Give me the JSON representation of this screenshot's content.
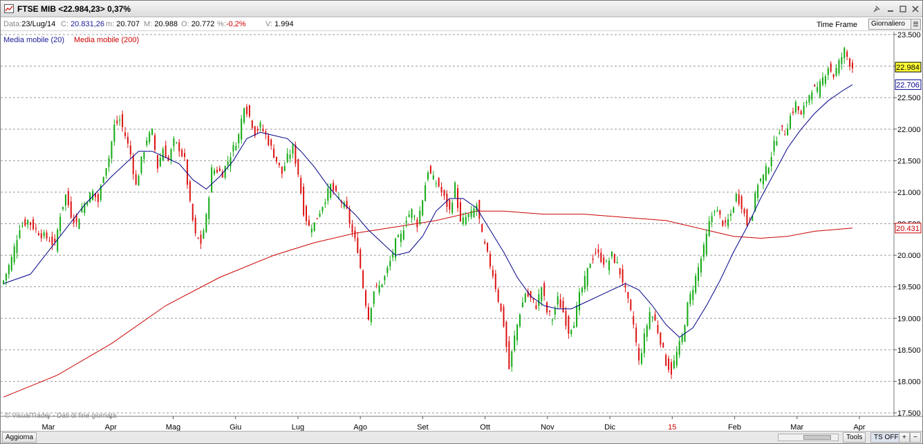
{
  "window": {
    "title": "FTSE MIB <22.984,23> 0,37%",
    "buttons": [
      "pin-icon",
      "minimize-icon",
      "restore-icon",
      "close-icon"
    ]
  },
  "infobar": {
    "date_label": "Data:",
    "date_value": "23/Lug/14",
    "close_label": "C:",
    "close_value": "20.831,26",
    "min_label": "m:",
    "min_value": "20.707",
    "max_label": "M:",
    "max_value": "20.988",
    "open_label": "O:",
    "open_value": "20.772",
    "pct_label": "%:",
    "pct_value": "-0,2%",
    "vol_label": "V:",
    "vol_value": "1.994",
    "timeframe_label": "Time Frame",
    "timeframe_value": "Giornaliero"
  },
  "legend": {
    "ma20": "Media mobile (20)",
    "ma200": "Media mobile (200)"
  },
  "watermark": "© VisualTrader - Dati di fine giornata",
  "statusbar": {
    "refresh": "Aggiorna",
    "tools": "Tools",
    "ts": "TS OFF",
    "plus": "+",
    "minus": "−"
  },
  "colors": {
    "up": "#11aa11",
    "down": "#dd1111",
    "ma20": "#000088",
    "ma200": "#cc0000",
    "last_price_bg": "#ffff33",
    "grid": "#999999"
  },
  "chart_data": {
    "type": "candlestick",
    "y_ticks": [
      "23.500",
      "23.000",
      "22.500",
      "22.000",
      "21.500",
      "21.000",
      "20.500",
      "20.000",
      "19.500",
      "19.000",
      "18.500",
      "18.000",
      "17.500"
    ],
    "y_tick_values": [
      23500,
      23000,
      22500,
      22000,
      21500,
      21000,
      20500,
      20000,
      19500,
      19000,
      18500,
      18000,
      17500
    ],
    "ylim": [
      17500,
      23500
    ],
    "x_ticks": [
      "Mar",
      "Apr",
      "Mag",
      "Giu",
      "Lug",
      "Ago",
      "Set",
      "Ott",
      "Nov",
      "Dic",
      "15",
      "Feb",
      "Mar",
      "Apr"
    ],
    "x_tick_highlight": [
      "15"
    ],
    "grid": "horizontal dashed",
    "price_labels": [
      {
        "text": "22.984",
        "value": 22984,
        "style": "last"
      },
      {
        "text": "22.706",
        "value": 22706,
        "style": "ma20"
      },
      {
        "text": "20.431",
        "value": 20431,
        "style": "ma200"
      }
    ],
    "series": [
      {
        "name": "Media mobile (20)",
        "color": "#000088"
      },
      {
        "name": "Media mobile (200)",
        "color": "#cc0000"
      }
    ],
    "anchors": [
      [
        0,
        19600
      ],
      [
        3,
        19950
      ],
      [
        6,
        20450
      ],
      [
        9,
        20550
      ],
      [
        12,
        20400
      ],
      [
        15,
        20300
      ],
      [
        17,
        20250
      ],
      [
        19,
        20150
      ],
      [
        21,
        20650
      ],
      [
        23,
        20950
      ],
      [
        25,
        20650
      ],
      [
        27,
        20500
      ],
      [
        29,
        20750
      ],
      [
        31,
        20900
      ],
      [
        33,
        21000
      ],
      [
        35,
        20850
      ],
      [
        37,
        21300
      ],
      [
        39,
        21550
      ],
      [
        41,
        22050
      ],
      [
        43,
        22150
      ],
      [
        45,
        21900
      ],
      [
        47,
        21600
      ],
      [
        49,
        21100
      ],
      [
        51,
        21500
      ],
      [
        53,
        21850
      ],
      [
        55,
        21950
      ],
      [
        57,
        21400
      ],
      [
        59,
        21700
      ],
      [
        61,
        21500
      ],
      [
        63,
        21800
      ],
      [
        65,
        21700
      ],
      [
        67,
        21500
      ],
      [
        69,
        20800
      ],
      [
        71,
        20300
      ],
      [
        73,
        20200
      ],
      [
        75,
        20600
      ],
      [
        77,
        21350
      ],
      [
        79,
        21350
      ],
      [
        81,
        21300
      ],
      [
        83,
        21500
      ],
      [
        85,
        21700
      ],
      [
        87,
        21900
      ],
      [
        89,
        22400
      ],
      [
        91,
        22200
      ],
      [
        93,
        21950
      ],
      [
        95,
        22050
      ],
      [
        97,
        21900
      ],
      [
        99,
        21700
      ],
      [
        101,
        21500
      ],
      [
        103,
        21300
      ],
      [
        105,
        21550
      ],
      [
        107,
        21700
      ],
      [
        109,
        21300
      ],
      [
        111,
        20700
      ],
      [
        113,
        20450
      ],
      [
        115,
        20500
      ],
      [
        117,
        20700
      ],
      [
        119,
        20900
      ],
      [
        121,
        21100
      ],
      [
        123,
        20950
      ],
      [
        125,
        20850
      ],
      [
        127,
        20700
      ],
      [
        129,
        20350
      ],
      [
        131,
        20100
      ],
      [
        133,
        19500
      ],
      [
        135,
        19000
      ],
      [
        137,
        19450
      ],
      [
        139,
        19500
      ],
      [
        141,
        19650
      ],
      [
        143,
        19900
      ],
      [
        145,
        20200
      ],
      [
        147,
        20300
      ],
      [
        149,
        20600
      ],
      [
        151,
        20700
      ],
      [
        153,
        20500
      ],
      [
        155,
        20900
      ],
      [
        157,
        21350
      ],
      [
        159,
        21200
      ],
      [
        161,
        21100
      ],
      [
        163,
        20900
      ],
      [
        165,
        20700
      ],
      [
        167,
        21100
      ],
      [
        169,
        20500
      ],
      [
        171,
        20600
      ],
      [
        173,
        20650
      ],
      [
        175,
        20800
      ],
      [
        177,
        20300
      ],
      [
        179,
        20000
      ],
      [
        181,
        19700
      ],
      [
        183,
        19300
      ],
      [
        185,
        18900
      ],
      [
        187,
        18200
      ],
      [
        189,
        18700
      ],
      [
        191,
        19100
      ],
      [
        193,
        19400
      ],
      [
        195,
        19300
      ],
      [
        197,
        19200
      ],
      [
        199,
        19500
      ],
      [
        201,
        19100
      ],
      [
        203,
        19000
      ],
      [
        205,
        19300
      ],
      [
        207,
        19100
      ],
      [
        209,
        18800
      ],
      [
        211,
        18950
      ],
      [
        213,
        19350
      ],
      [
        215,
        19600
      ],
      [
        217,
        19900
      ],
      [
        219,
        20050
      ],
      [
        221,
        19950
      ],
      [
        223,
        19850
      ],
      [
        225,
        20000
      ],
      [
        227,
        19850
      ],
      [
        229,
        19600
      ],
      [
        231,
        19250
      ],
      [
        233,
        18900
      ],
      [
        235,
        18300
      ],
      [
        237,
        18700
      ],
      [
        239,
        19100
      ],
      [
        241,
        18950
      ],
      [
        243,
        18650
      ],
      [
        245,
        18300
      ],
      [
        247,
        18150
      ],
      [
        249,
        18450
      ],
      [
        251,
        18700
      ],
      [
        253,
        19200
      ],
      [
        255,
        19500
      ],
      [
        257,
        19800
      ],
      [
        259,
        20100
      ],
      [
        261,
        20500
      ],
      [
        263,
        20750
      ],
      [
        265,
        20600
      ],
      [
        267,
        20450
      ],
      [
        269,
        20650
      ],
      [
        271,
        20950
      ],
      [
        273,
        20800
      ],
      [
        275,
        20500
      ],
      [
        277,
        20700
      ],
      [
        279,
        21150
      ],
      [
        281,
        21250
      ],
      [
        283,
        21450
      ],
      [
        285,
        21750
      ],
      [
        287,
        22000
      ],
      [
        289,
        21950
      ],
      [
        291,
        22200
      ],
      [
        293,
        22400
      ],
      [
        295,
        22200
      ],
      [
        297,
        22450
      ],
      [
        299,
        22650
      ],
      [
        301,
        22600
      ],
      [
        303,
        22800
      ],
      [
        305,
        23000
      ],
      [
        307,
        22850
      ],
      [
        309,
        23050
      ],
      [
        311,
        23250
      ],
      [
        313,
        23050
      ],
      [
        314,
        22984
      ]
    ],
    "ma20_points": [
      [
        0,
        19550
      ],
      [
        10,
        19700
      ],
      [
        20,
        20250
      ],
      [
        30,
        20800
      ],
      [
        40,
        21250
      ],
      [
        50,
        21650
      ],
      [
        55,
        21650
      ],
      [
        60,
        21550
      ],
      [
        65,
        21450
      ],
      [
        70,
        21200
      ],
      [
        75,
        21050
      ],
      [
        80,
        21250
      ],
      [
        85,
        21500
      ],
      [
        90,
        21850
      ],
      [
        95,
        21950
      ],
      [
        100,
        21900
      ],
      [
        105,
        21850
      ],
      [
        110,
        21650
      ],
      [
        115,
        21400
      ],
      [
        120,
        21100
      ],
      [
        125,
        20850
      ],
      [
        130,
        20650
      ],
      [
        135,
        20400
      ],
      [
        140,
        20200
      ],
      [
        145,
        20000
      ],
      [
        150,
        20050
      ],
      [
        155,
        20300
      ],
      [
        160,
        20700
      ],
      [
        165,
        20900
      ],
      [
        170,
        20900
      ],
      [
        175,
        20750
      ],
      [
        180,
        20400
      ],
      [
        185,
        20050
      ],
      [
        190,
        19650
      ],
      [
        195,
        19350
      ],
      [
        200,
        19200
      ],
      [
        205,
        19150
      ],
      [
        210,
        19150
      ],
      [
        215,
        19250
      ],
      [
        220,
        19350
      ],
      [
        225,
        19450
      ],
      [
        230,
        19550
      ],
      [
        235,
        19450
      ],
      [
        240,
        19200
      ],
      [
        245,
        18900
      ],
      [
        250,
        18700
      ],
      [
        255,
        18850
      ],
      [
        260,
        19200
      ],
      [
        265,
        19600
      ],
      [
        270,
        20050
      ],
      [
        275,
        20450
      ],
      [
        280,
        20900
      ],
      [
        285,
        21300
      ],
      [
        290,
        21700
      ],
      [
        295,
        22000
      ],
      [
        300,
        22250
      ],
      [
        305,
        22450
      ],
      [
        310,
        22600
      ],
      [
        314,
        22706
      ]
    ],
    "ma200_points": [
      [
        0,
        17750
      ],
      [
        20,
        18100
      ],
      [
        40,
        18600
      ],
      [
        60,
        19200
      ],
      [
        80,
        19650
      ],
      [
        100,
        20000
      ],
      [
        115,
        20200
      ],
      [
        130,
        20350
      ],
      [
        145,
        20450
      ],
      [
        160,
        20550
      ],
      [
        175,
        20700
      ],
      [
        185,
        20700
      ],
      [
        200,
        20650
      ],
      [
        215,
        20650
      ],
      [
        230,
        20600
      ],
      [
        245,
        20550
      ],
      [
        260,
        20400
      ],
      [
        270,
        20300
      ],
      [
        280,
        20270
      ],
      [
        290,
        20300
      ],
      [
        300,
        20380
      ],
      [
        314,
        20431
      ]
    ]
  }
}
